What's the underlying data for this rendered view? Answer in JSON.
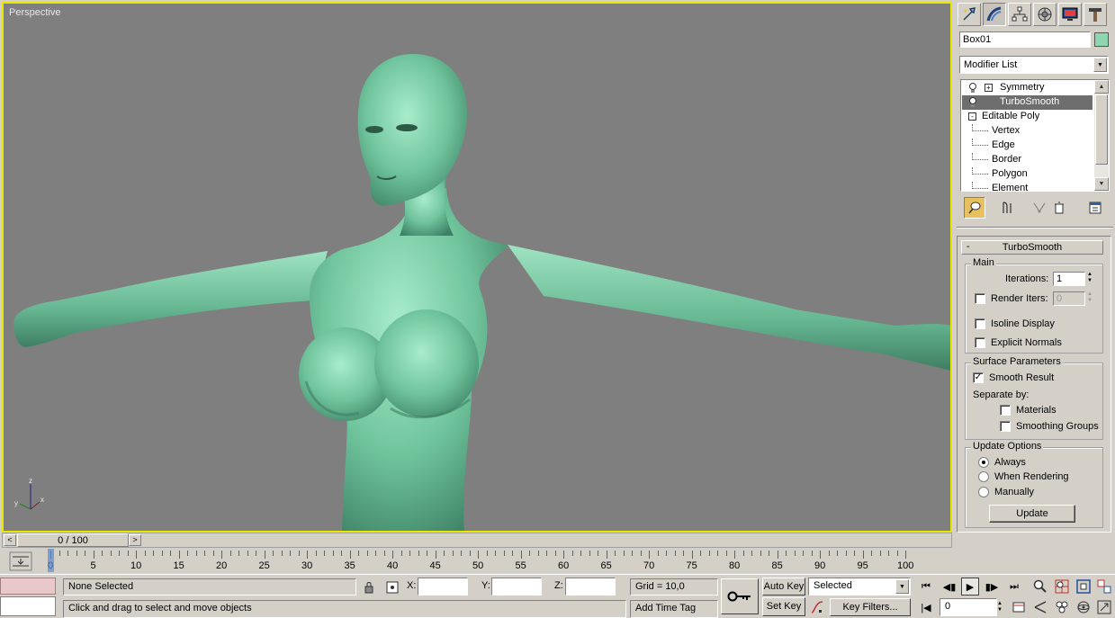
{
  "viewport": {
    "label": "Perspective",
    "axis_z": "z",
    "axis_x": "x",
    "axis_y": "y"
  },
  "command_panel": {
    "tabs": [
      "create-icon",
      "modify-icon",
      "hierarchy-icon",
      "motion-icon",
      "display-icon",
      "utilities-icon"
    ],
    "object_name": "Box01",
    "object_color": "#8ed6b0",
    "modifier_list": "Modifier List",
    "stack": {
      "symmetry": "Symmetry",
      "turbosmooth": "TurboSmooth",
      "editable_poly": "Editable Poly",
      "vertex": "Vertex",
      "edge": "Edge",
      "border": "Border",
      "polygon": "Polygon",
      "element": "Element"
    }
  },
  "turbosmooth": {
    "title": "TurboSmooth",
    "collapse": "-",
    "main": {
      "title": "Main",
      "iterations_label": "Iterations:",
      "iterations_value": "1",
      "render_iters_label": "Render Iters:",
      "render_iters_value": "0",
      "isoline_display": "Isoline Display",
      "explicit_normals": "Explicit Normals"
    },
    "surface": {
      "title": "Surface Parameters",
      "smooth_result": "Smooth Result",
      "separate_by": "Separate by:",
      "materials": "Materials",
      "smoothing_groups": "Smoothing Groups"
    },
    "update": {
      "title": "Update Options",
      "always": "Always",
      "when_rendering": "When Rendering",
      "manually": "Manually",
      "update_button": "Update"
    }
  },
  "time": {
    "slider_label": "0 / 100",
    "prev": "<",
    "next": ">",
    "ticks": [
      "0",
      "5",
      "10",
      "15",
      "20",
      "25",
      "30",
      "35",
      "40",
      "45",
      "50",
      "55",
      "60",
      "65",
      "70",
      "75",
      "80",
      "85",
      "90",
      "95",
      "100"
    ]
  },
  "status": {
    "selection": "None Selected",
    "prompt": "Click and drag to select and move objects",
    "x_label": "X:",
    "y_label": "Y:",
    "z_label": "Z:",
    "grid": "Grid = 10,0",
    "add_time_tag": "Add Time Tag",
    "auto_key": "Auto Key",
    "set_key": "Set Key",
    "key_mode": "Selected",
    "key_filters": "Key Filters...",
    "current_frame": "0"
  }
}
